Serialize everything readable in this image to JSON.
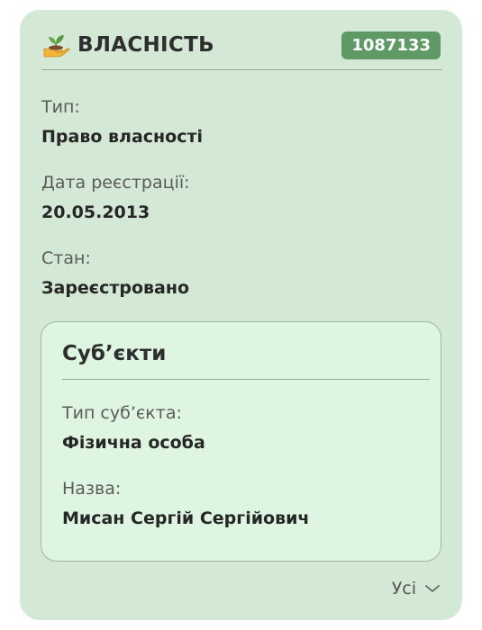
{
  "property": {
    "title": "ВЛАСНІСТЬ",
    "id_badge": "1087133",
    "icon": "seedling-in-hand-icon"
  },
  "fields": {
    "type": {
      "label": "Тип:",
      "value": "Право власності"
    },
    "registration_date": {
      "label": "Дата реєстрації:",
      "value": "20.05.2013"
    },
    "status": {
      "label": "Стан:",
      "value": "Зареєстровано"
    }
  },
  "subjects": {
    "title": "Суб’єкти",
    "subject_type": {
      "label": "Тип суб’єкта:",
      "value": "Фізична особа"
    },
    "name": {
      "label": "Назва:",
      "value": "Мисан Сергій Сергійович"
    }
  },
  "footer": {
    "more_label": "Усі",
    "more_icon": "chevron-down-icon"
  },
  "colors": {
    "card_background": "#d3e9d6",
    "subjects_background": "#def6e1",
    "badge_background": "#5f9a66"
  }
}
